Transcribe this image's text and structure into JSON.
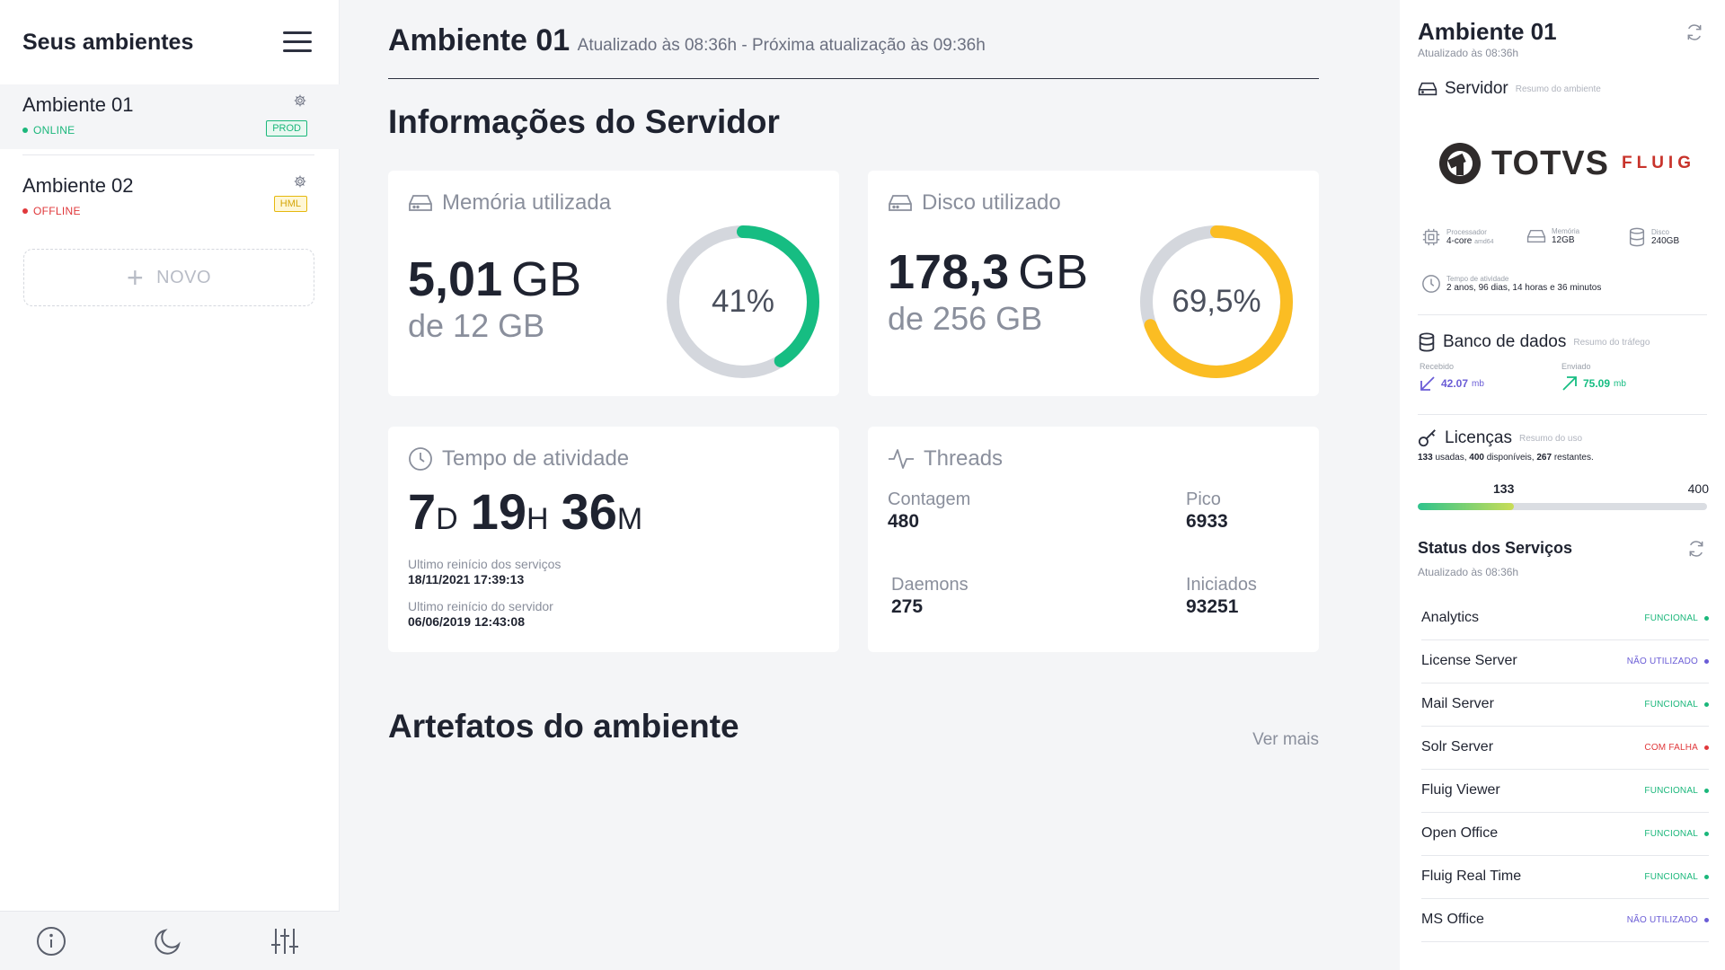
{
  "sidebar": {
    "title": "Seus ambientes",
    "environments": [
      {
        "name": "Ambiente 01",
        "status": "ONLINE",
        "badge": "PROD"
      },
      {
        "name": "Ambiente 02",
        "status": "OFFLINE",
        "badge": "HML"
      }
    ],
    "new_label": "NOVO",
    "footer_icons": [
      "info-icon",
      "moon-icon",
      "sliders-icon"
    ]
  },
  "colors": {
    "online": "#1bb77b",
    "offline": "#e0383b",
    "prod_badge": "#1bb77b",
    "hml_badge": "#e5b80e",
    "memory_ring": "#16bd82",
    "disk_ring": "#fbbd23",
    "ring_track": "#d4d7dd",
    "received": "#6a5cd6",
    "sent": "#16bd82",
    "not_used": "#6a5cd6",
    "failure": "#e0383b"
  },
  "main": {
    "title": "Ambiente 01",
    "subtitle": "Atualizado às 08:36h - Próxima atualização às 09:36h",
    "server_section": "Informações do Servidor",
    "memory": {
      "title": "Memória utilizada",
      "value": "5,01",
      "unit": "GB",
      "of": "de 12 GB",
      "percent": 41,
      "percent_label": "41%"
    },
    "disk": {
      "title": "Disco utilizado",
      "value": "178,3",
      "unit": "GB",
      "of": "de 256 GB",
      "percent": 69.5,
      "percent_label": "69,5%"
    },
    "uptime": {
      "title": "Tempo de atividade",
      "days": "7",
      "days_unit": "D",
      "hours": "19",
      "hours_unit": "H",
      "minutes": "36",
      "minutes_unit": "M",
      "services_restart_label": "Ultimo reinício dos serviços",
      "services_restart_value": "18/11/2021 17:39:13",
      "server_restart_label": "Ultimo reinício do servidor",
      "server_restart_value": "06/06/2019 12:43:08"
    },
    "threads": {
      "title": "Threads",
      "count_label": "Contagem",
      "count_value": "480",
      "peak_label": "Pico",
      "peak_value": "6933",
      "daemons_label": "Daemons",
      "daemons_value": "275",
      "started_label": "Iniciados",
      "started_value": "93251"
    },
    "artifacts_section": "Artefatos do ambiente",
    "see_more": "Ver mais"
  },
  "panel": {
    "title": "Ambiente 01",
    "subtitle": "Atualizado às 08:36h",
    "server": {
      "title": "Servidor",
      "hint": "Resumo do ambiente",
      "logo_text": "TOTVS",
      "logo_sub": "FLUIG",
      "processor_label": "Processador",
      "processor_value": "4-core",
      "processor_arch": "amd64",
      "memory_label": "Memória",
      "memory_value": "12GB",
      "disk_label": "Disco",
      "disk_value": "240GB",
      "uptime_label": "Tempo de atividade",
      "uptime_value": "2 anos, 96 dias, 14 horas e 36 minutos"
    },
    "database": {
      "title": "Banco de dados",
      "hint": "Resumo do tráfego",
      "received_label": "Recebido",
      "received_value": "42.07",
      "received_unit": "mb",
      "sent_label": "Enviado",
      "sent_value": "75.09",
      "sent_unit": "mb"
    },
    "licenses": {
      "title": "Licenças",
      "hint": "Resumo do uso",
      "used": "133",
      "used_text": "usadas,",
      "available": "400",
      "available_text": "disponíveis,",
      "remaining": "267",
      "remaining_text": "restantes.",
      "bar_used_label": "133",
      "bar_total_label": "400",
      "fraction_used": 0.3325
    },
    "services": {
      "title": "Status dos Serviços",
      "subtitle": "Atualizado às 08:36h",
      "items": [
        {
          "name": "Analytics",
          "status": "FUNCIONAL",
          "state": "ok"
        },
        {
          "name": "License Server",
          "status": "NÃO UTILIZADO",
          "state": "unused"
        },
        {
          "name": "Mail Server",
          "status": "FUNCIONAL",
          "state": "ok"
        },
        {
          "name": "Solr Server",
          "status": "COM FALHA",
          "state": "fail"
        },
        {
          "name": "Fluig Viewer",
          "status": "FUNCIONAL",
          "state": "ok"
        },
        {
          "name": "Open Office",
          "status": "FUNCIONAL",
          "state": "ok"
        },
        {
          "name": "Fluig Real Time",
          "status": "FUNCIONAL",
          "state": "ok"
        },
        {
          "name": "MS Office",
          "status": "NÃO UTILIZADO",
          "state": "unused"
        }
      ]
    }
  }
}
